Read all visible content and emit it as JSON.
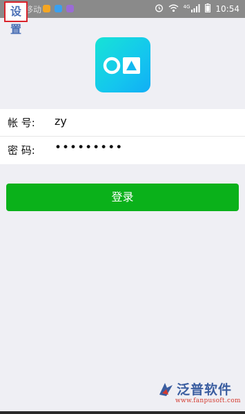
{
  "status_bar": {
    "carrier": "中国移动",
    "time": "10:54",
    "network": "4G",
    "notification_icons": [
      {
        "name": "orange-app-icon",
        "color": "#f5a623"
      },
      {
        "name": "blue-app-icon",
        "color": "#3aa0f0"
      },
      {
        "name": "purple-app-icon",
        "color": "#9b6bd6"
      }
    ],
    "status_icons": [
      "alarm-icon",
      "wifi-icon",
      "signal-icon",
      "battery-icon"
    ]
  },
  "header": {
    "settings_label": "设置"
  },
  "logo": {
    "icon": "oa-logo-icon",
    "colors": [
      "#17e3d6",
      "#11aef5"
    ]
  },
  "form": {
    "account_label": "帐 号:",
    "account_value": "zy",
    "password_label": "密 码:",
    "password_value": "•••••••••"
  },
  "login": {
    "button_label": "登录",
    "button_color": "#0ab11a"
  },
  "watermark": {
    "title": "泛普软件",
    "url": "www.fanpusoft.com"
  }
}
